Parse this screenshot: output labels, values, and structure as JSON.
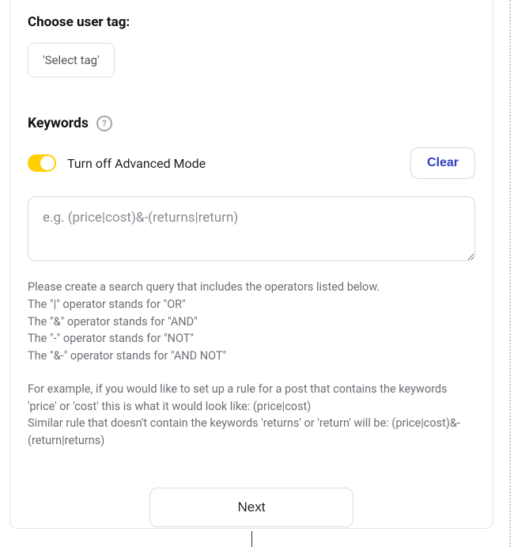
{
  "userTag": {
    "heading": "Choose user tag:",
    "selectLabel": "'Select tag'"
  },
  "keywords": {
    "heading": "Keywords",
    "helpIcon": "?",
    "toggleLabel": "Turn off Advanced Mode",
    "clearLabel": "Clear",
    "placeholder": "e.g. (price|cost)&-(returns|return)",
    "value": "",
    "help": {
      "intro": "Please create a search query that includes the operators listed below.",
      "orLine": "The \"|\" operator stands for \"OR\"",
      "andLine": "The \"&\" operator stands for \"AND\"",
      "notLine": "The \"-\" operator stands for \"NOT\"",
      "andNotLine": "The \"&-\" operator stands for \"AND NOT\"",
      "example1": "For example, if you would like to set up a rule for a post that contains the keywords 'price' or 'cost' this is what it would look like: (price|cost)",
      "example2": "Similar rule that doesn't contain the keywords 'returns' or 'return' will be: (price|cost)&-(return|returns)"
    }
  },
  "footer": {
    "nextLabel": "Next"
  }
}
